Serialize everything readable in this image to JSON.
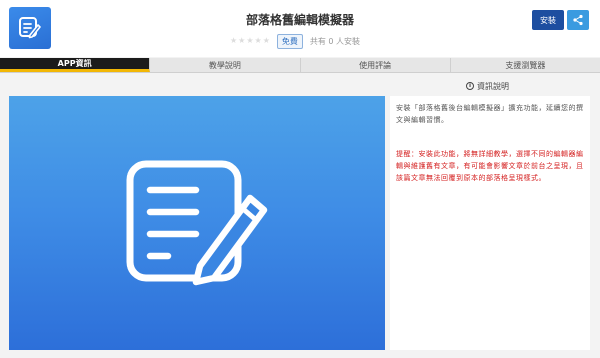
{
  "app": {
    "title": "部落格舊編輯模擬器",
    "price_badge": "免費",
    "installs": "共有 0 人安裝",
    "rating_stars": 5,
    "rating_value": 0,
    "icon": "edit-note-icon"
  },
  "actions": {
    "install_label": "安裝",
    "share_icon": "share-icon"
  },
  "tabs": [
    {
      "label": "APP資訊",
      "active": true
    },
    {
      "label": "教學說明",
      "active": false
    },
    {
      "label": "使用評論",
      "active": false
    },
    {
      "label": "支援瀏覽器",
      "active": false
    }
  ],
  "info": {
    "heading": "資訊說明"
  },
  "description": {
    "main": "安裝「部落格舊後台編輯模擬器」擴充功能，延續您的撰文與編輯習慣。",
    "warning": "提醒：安裝此功能，將無詳細教學，選擇不同的編輯器編輯與維護舊有文章，有可能會影響文章於前台之呈現，且該篇文章無法回覆到原本的部落格呈現樣式。"
  },
  "colors": {
    "brand_blue": "#1d4ea0",
    "share_blue": "#3a9be0",
    "active_tab_bg": "#1b1b1b",
    "active_tab_accent": "#f2b705",
    "warning_red": "#d42020"
  }
}
